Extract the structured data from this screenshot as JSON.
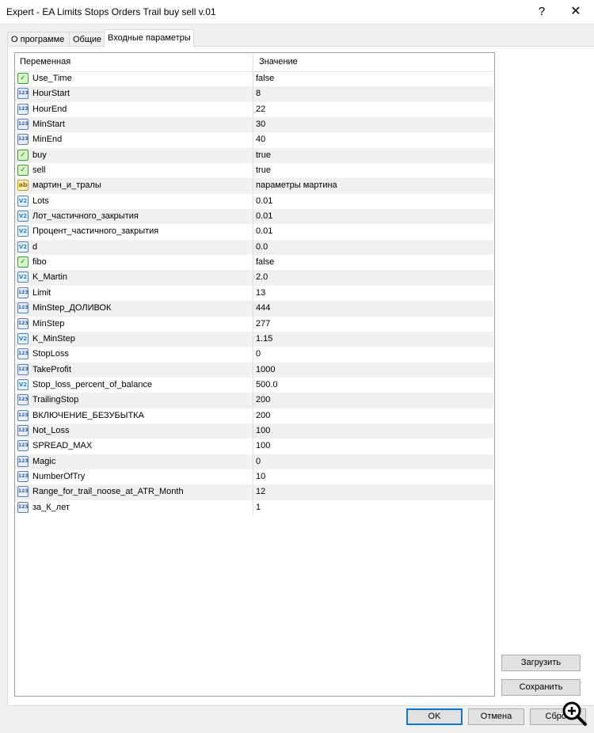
{
  "window": {
    "title": "Expert - EA Limits Stops Orders Trail buy sell v.01",
    "help": "?",
    "close": "✕"
  },
  "tabs": [
    {
      "label": "О программе"
    },
    {
      "label": "Общие"
    },
    {
      "label": "Входные параметры"
    }
  ],
  "grid": {
    "col_variable": "Переменная",
    "col_value": "Значение",
    "rows": [
      {
        "type": "bool",
        "name": "Use_Time",
        "value": "false"
      },
      {
        "type": "int",
        "name": "HourStart",
        "value": "8"
      },
      {
        "type": "int",
        "name": "HourEnd",
        "value": "22"
      },
      {
        "type": "int",
        "name": "MinStart",
        "value": "30"
      },
      {
        "type": "int",
        "name": "MinEnd",
        "value": "40"
      },
      {
        "type": "bool",
        "name": "buy",
        "value": "true"
      },
      {
        "type": "bool",
        "name": "sell",
        "value": "true"
      },
      {
        "type": "str",
        "name": "мартин_и_тралы",
        "value": "параметры мартина"
      },
      {
        "type": "dbl",
        "name": "Lots",
        "value": "0.01"
      },
      {
        "type": "dbl",
        "name": "Лот_частичного_закрытия",
        "value": "0.01"
      },
      {
        "type": "dbl",
        "name": "Процент_частичного_закрытия",
        "value": "0.01"
      },
      {
        "type": "dbl",
        "name": "d",
        "value": "0.0"
      },
      {
        "type": "bool",
        "name": "fibo",
        "value": "false"
      },
      {
        "type": "dbl",
        "name": "K_Martin",
        "value": "2.0"
      },
      {
        "type": "int",
        "name": "Limit",
        "value": "13"
      },
      {
        "type": "int",
        "name": "MinStep_ДОЛИВОК",
        "value": "444"
      },
      {
        "type": "int",
        "name": "MinStep",
        "value": "277"
      },
      {
        "type": "dbl",
        "name": "K_MinStep",
        "value": "1.15"
      },
      {
        "type": "int",
        "name": "StopLoss",
        "value": "0"
      },
      {
        "type": "int",
        "name": "TakeProfit",
        "value": "1000"
      },
      {
        "type": "dbl",
        "name": "Stop_loss_percent_of_balance",
        "value": "500.0"
      },
      {
        "type": "int",
        "name": "TrailingStop",
        "value": "200"
      },
      {
        "type": "int",
        "name": "ВКЛЮЧЕНИЕ_БЕЗУБЫТКА",
        "value": "200"
      },
      {
        "type": "int",
        "name": "Not_Loss",
        "value": "100"
      },
      {
        "type": "int",
        "name": "SPREAD_MAX",
        "value": "100"
      },
      {
        "type": "int",
        "name": "Magic",
        "value": "0"
      },
      {
        "type": "int",
        "name": "NumberOfTry",
        "value": "10"
      },
      {
        "type": "int",
        "name": "Range_for_trail_noose_at_ATR_Month",
        "value": "12"
      },
      {
        "type": "int",
        "name": "за_К_лет",
        "value": "1"
      }
    ]
  },
  "icons": {
    "bool": "✓",
    "int": "123",
    "dbl": "V2",
    "str": "ab"
  },
  "buttons": {
    "load": "Загрузить",
    "save": "Сохранить",
    "ok": "OK",
    "cancel": "Отмена",
    "reset": "Сброс"
  }
}
